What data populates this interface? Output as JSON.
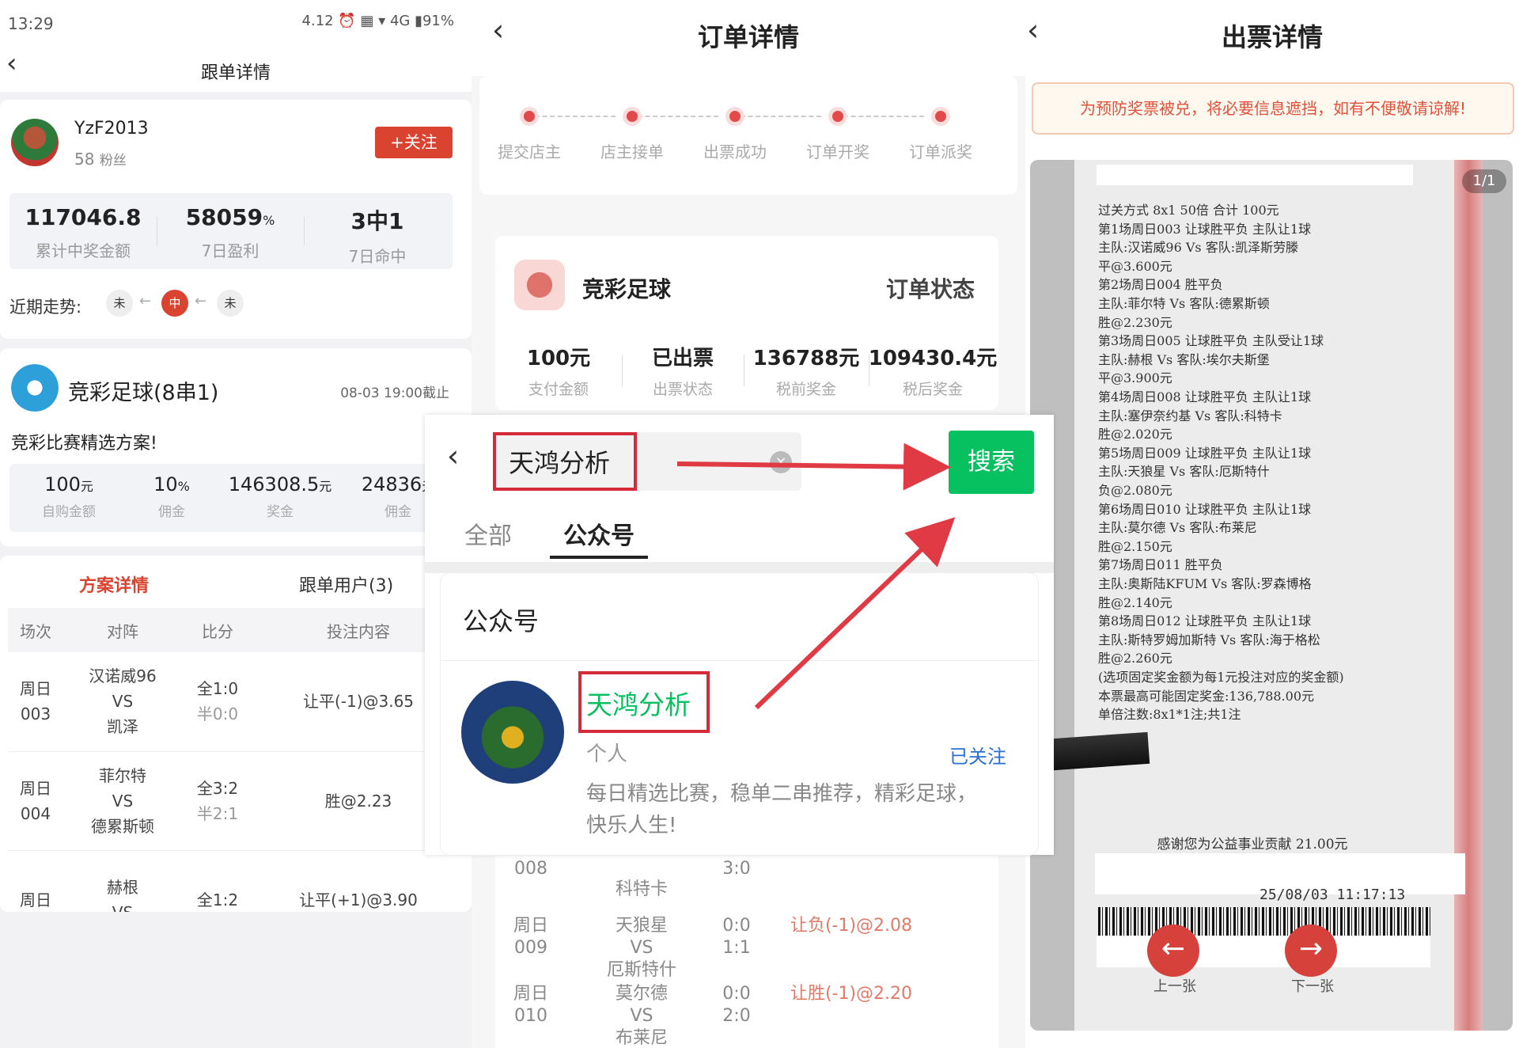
{
  "panel1": {
    "status": {
      "time": "13:29",
      "icons": "4.12 ⏰ ▦ ▾ 4G ▮91%"
    },
    "nav_title": "跟单详情",
    "user": {
      "name": "YzF2013",
      "fans": "58",
      "fans_unit": "粉丝",
      "follow_label": "+关注"
    },
    "stats": [
      {
        "value": "117046.8",
        "unit": "",
        "label": "累计中奖金额"
      },
      {
        "value": "58059",
        "unit": "%",
        "label": "7日盈利"
      },
      {
        "value": "3中1",
        "unit": "",
        "label": "7日命中"
      }
    ],
    "trend": {
      "label": "近期走势:",
      "items": [
        "未",
        "中",
        "未"
      ]
    },
    "plan": {
      "title": "竞彩足球(8串1)",
      "deadline": "08-03 19:00截止",
      "desc": "竞彩比赛精选方案!",
      "stats": [
        {
          "value": "100",
          "unit": "元",
          "label": "自购金额"
        },
        {
          "value": "10",
          "unit": "%",
          "label": "佣金"
        },
        {
          "value": "146308.5",
          "unit": "元",
          "label": "奖金"
        },
        {
          "value": "24836",
          "unit": "元",
          "label": "佣金"
        }
      ],
      "tabs": [
        "方案详情",
        "跟单用户(3)"
      ],
      "columns": [
        "场次",
        "对阵",
        "比分",
        "投注内容"
      ],
      "rows": [
        {
          "day": "周日",
          "no": "003",
          "home": "汉诺威96",
          "vs": "VS",
          "away": "凯泽",
          "full": "全1:0",
          "half": "半0:0",
          "bet": "让平(-1)@3.65"
        },
        {
          "day": "周日",
          "no": "004",
          "home": "菲尔特",
          "vs": "VS",
          "away": "德累斯顿",
          "full": "全3:2",
          "half": "半2:1",
          "bet": "胜@2.23"
        },
        {
          "day": "周日",
          "no": "",
          "home": "赫根",
          "vs": "VS",
          "away": "",
          "full": "全1:2",
          "half": "",
          "bet": "让平(+1)@3.90"
        }
      ]
    }
  },
  "panel2": {
    "title": "订单详情",
    "steps": [
      "提交店主",
      "店主接单",
      "出票成功",
      "订单开奖",
      "订单派奖"
    ],
    "order": {
      "game": "竞彩足球",
      "status_title": "订单状态",
      "stats": [
        {
          "value": "100元",
          "label": "支付金额"
        },
        {
          "value": "已出票",
          "label": "出票状态"
        },
        {
          "value": "136788元",
          "label": "税前奖金"
        },
        {
          "value": "109430.4元",
          "label": "税后奖金"
        }
      ]
    },
    "lower_rows": [
      {
        "day": "周日",
        "no": "008",
        "away": "科特卡",
        "full": "",
        "half": "3:0",
        "bet": ""
      },
      {
        "day": "周日",
        "no": "009",
        "home": "天狼星",
        "vs": "VS",
        "away": "厄斯特什",
        "full": "0:0",
        "half": "1:1",
        "bet": "让负(-1)@2.08"
      },
      {
        "day": "周日",
        "no": "010",
        "home": "莫尔德",
        "vs": "VS",
        "away": "布莱尼",
        "full": "0:0",
        "half": "2:0",
        "bet": "让胜(-1)@2.20"
      }
    ]
  },
  "search_overlay": {
    "query": "天鸿分析",
    "search_button": "搜索",
    "tabs": [
      "全部",
      "公众号"
    ],
    "section_title": "公众号",
    "result": {
      "name": "天鸿分析",
      "type": "个人",
      "status": "已关注",
      "desc_line1": "每日精选比赛，稳单二串推荐，精彩足球，",
      "desc_line2": "快乐人生!"
    },
    "colors": {
      "highlight": "#d42a3a",
      "green": "#07c160",
      "link": "#2a6fd6"
    }
  },
  "panel3": {
    "title": "出票详情",
    "notice": "为预防奖票被兑，将必要信息遮挡，如有不便敬请谅解!",
    "page_indicator": "1/1",
    "ticket_lines": [
      "过关方式 8x1        50倍        合计  100元",
      "第1场周日003  让球胜平负    主队让1球",
      "主队:汉诺威96 Vs  客队:凯泽斯劳滕",
      "平@3.600元",
      "第2场周日004  胜平负",
      "主队:菲尔特 Vs  客队:德累斯顿",
      "胜@2.230元",
      "第3场周日005  让球胜平负    主队受让1球",
      "主队:赫根  Vs  客队:埃尔夫斯堡",
      "平@3.900元",
      "第4场周日008  让球胜平负    主队让1球",
      "主队:塞伊奈约基 Vs  客队:科特卡",
      "胜@2.020元",
      "第5场周日009  让球胜平负    主队让1球",
      "主队:天狼星  Vs  客队:厄斯特什",
      "负@2.080元",
      "第6场周日010  让球胜平负    主队让1球",
      "主队:莫尔德  Vs  客队:布莱尼",
      "胜@2.150元",
      "第7场周日011  胜平负",
      "主队:奥斯陆KFUM  Vs  客队:罗森博格",
      "胜@2.140元",
      "第8场周日012  让球胜平负    主队让1球",
      "主队:斯特罗姆加斯特 Vs  客队:海于格松",
      "胜@2.260元",
      "(选项固定奖金额为每1元投注对应的奖金额)",
      "本票最高可能固定奖金:136,788.00元",
      "单倍注数:8x1*1注;共1注"
    ],
    "thanks": "感谢您为公益事业贡献 21.00元",
    "timestamp": "25/08/03 11:17:13",
    "prev_label": "上一张",
    "next_label": "下一张"
  }
}
